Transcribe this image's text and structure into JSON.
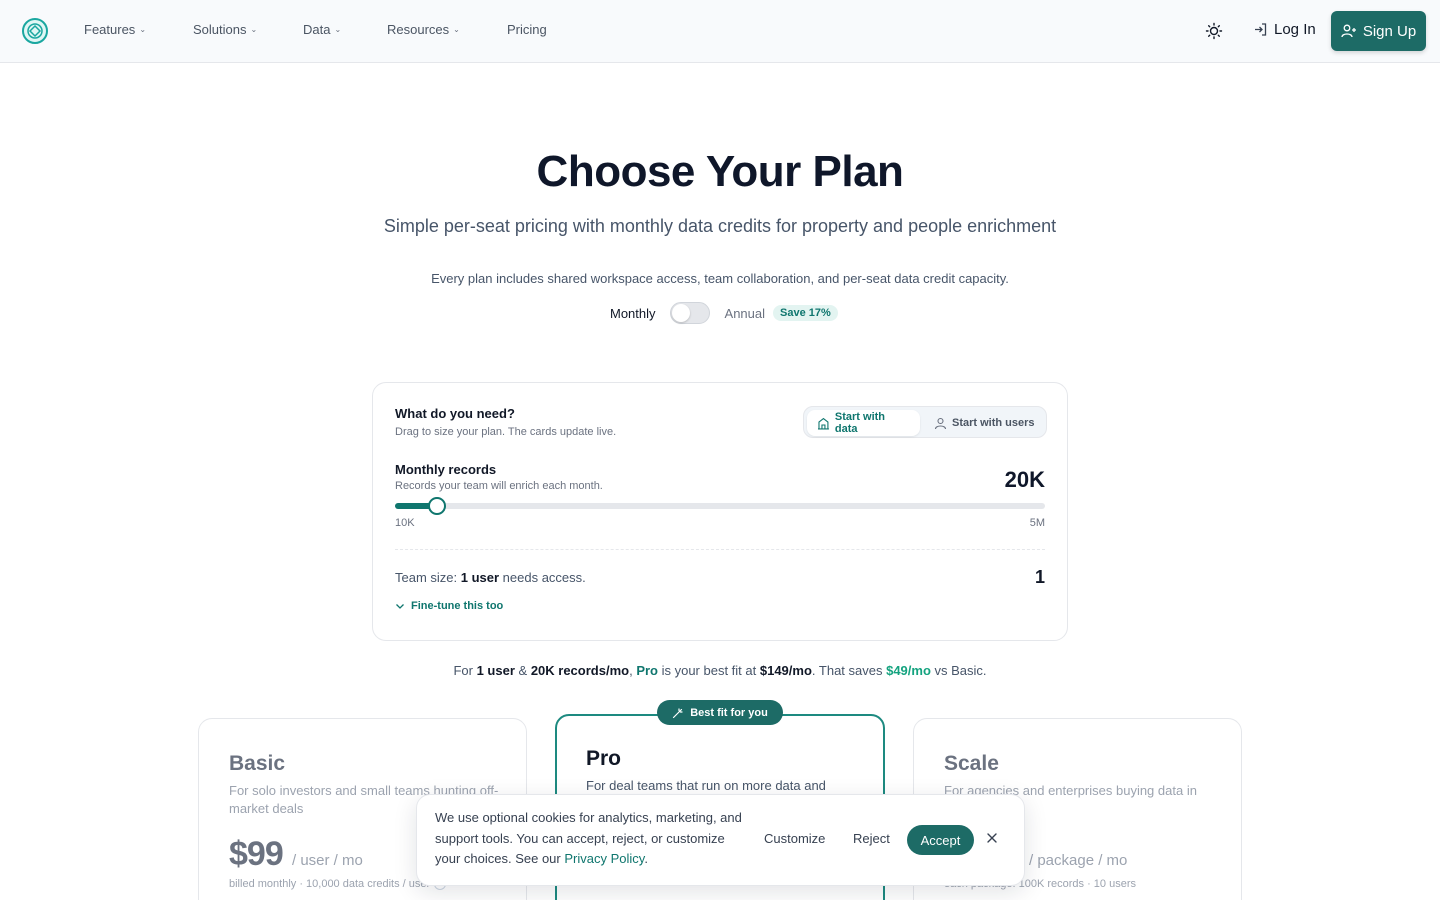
{
  "nav": {
    "items": [
      {
        "label": "Features",
        "dropdown": true
      },
      {
        "label": "Solutions",
        "dropdown": true
      },
      {
        "label": "Data",
        "dropdown": true
      },
      {
        "label": "Resources",
        "dropdown": true
      },
      {
        "label": "Pricing",
        "dropdown": false
      }
    ],
    "theme_icon": "sun-icon",
    "login_label": "Log In",
    "signup_label": "Sign Up"
  },
  "hero": {
    "title": "Choose Your Plan",
    "subtitle": "Simple per-seat pricing with monthly data credits for property and people enrichment",
    "note": "Every plan includes shared workspace access, team collaboration, and per-seat data credit capacity."
  },
  "billing": {
    "monthly_label": "Monthly",
    "annual_label": "Annual",
    "save_badge": "Save 17%",
    "annual_selected": false
  },
  "sizer": {
    "title": "What do you need?",
    "subtitle": "Drag to size your plan. The cards update live.",
    "modes": {
      "data": "Start with data",
      "users": "Start with users",
      "active": "data"
    },
    "records": {
      "label": "Monthly records",
      "sublabel": "Records your team will enrich each month.",
      "value": "20K",
      "min_label": "10K",
      "max_label": "5M",
      "fill_fraction": 0.064
    },
    "team": {
      "prefix": "Team size: ",
      "bold": "1 user",
      "suffix": " needs access.",
      "value": "1"
    },
    "finetune": "Fine-tune this too"
  },
  "bestfit": {
    "p1": "For ",
    "users": "1 user",
    "p2": " & ",
    "records": "20K records/mo",
    "p3": ", ",
    "plan": "Pro",
    "p4": " is your best fit at ",
    "price": "$149/mo",
    "p5": ". That saves ",
    "savings": "$49/mo",
    "p6": " vs Basic."
  },
  "plans": {
    "basic": {
      "name": "Basic",
      "desc": "For solo investors and small teams hunting off-market deals",
      "price": "$99",
      "unit": "/ user / mo",
      "billed": "billed monthly · 10,000 data credits / user"
    },
    "pro": {
      "badge": "Best fit for you",
      "name": "Pro",
      "desc": "For deal teams that run on more data and"
    },
    "scale": {
      "name": "Scale",
      "desc": "For agencies and enterprises buying data in",
      "unit": "/ package / mo",
      "billed": "each package: 100K records · 10 users"
    }
  },
  "cookie": {
    "text": "We use optional cookies for analytics, marketing, and support tools. You can accept, reject, or customize your choices. See our ",
    "link": "Privacy Policy",
    "end": ".",
    "customize": "Customize",
    "reject": "Reject",
    "accept": "Accept"
  },
  "colors": {
    "brand": "#1d6b66",
    "accent": "#0f766e",
    "savings": "#14a37f"
  }
}
